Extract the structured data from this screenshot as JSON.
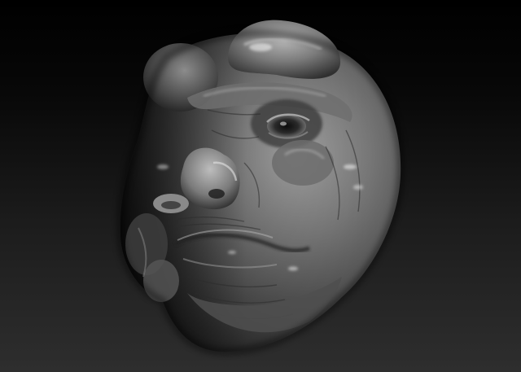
{
  "scene": {
    "subject": "sculpted-head",
    "colors": {
      "background_top": "#000000",
      "background_bottom": "#2e2e2e",
      "clay_base": "#5a5a5a",
      "clay_highlight": "#dcdcdc",
      "clay_shadow": "#111111"
    }
  }
}
